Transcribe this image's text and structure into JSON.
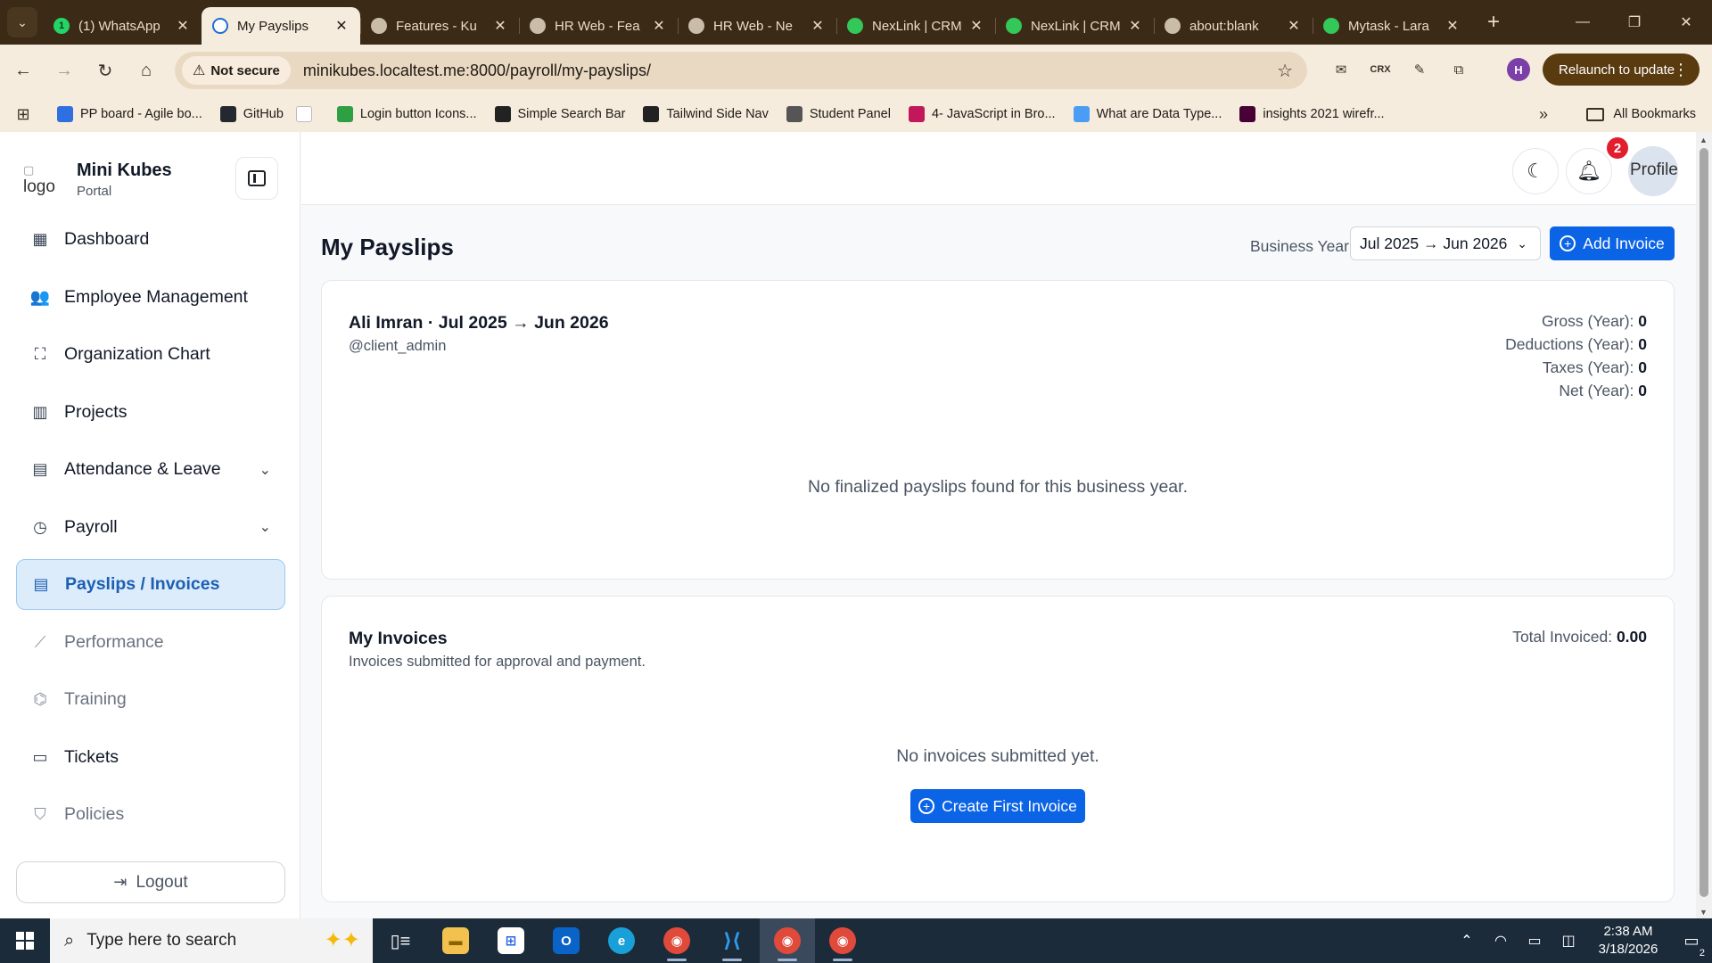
{
  "browser": {
    "tabs": [
      {
        "title": "(1) WhatsApp",
        "icon": "whatsapp-icon",
        "badge": "1",
        "color": "#25d366"
      },
      {
        "title": "My Payslips",
        "icon": "app-page-icon",
        "color": "#ffffff",
        "active": true
      },
      {
        "title": "Features - Ku",
        "icon": "globe-icon",
        "color": "#c9bca8"
      },
      {
        "title": "HR Web - Fea",
        "icon": "globe-icon",
        "color": "#c9bca8"
      },
      {
        "title": "HR Web - Ne",
        "icon": "globe-icon",
        "color": "#c9bca8"
      },
      {
        "title": "NexLink | CRM",
        "icon": "nexlink-icon",
        "color": "#34c759"
      },
      {
        "title": "NexLink | CRM",
        "icon": "nexlink-icon",
        "color": "#34c759"
      },
      {
        "title": "about:blank",
        "icon": "globe-icon",
        "color": "#c9bca8"
      },
      {
        "title": "Mytask - Lara",
        "icon": "nexlink-icon",
        "color": "#34c759"
      }
    ],
    "security_label": "Not secure",
    "url": "minikubes.localtest.me:8000/payroll/my-payslips/",
    "profile_initial": "H",
    "relaunch_label": "Relaunch to update",
    "bookmarks": [
      {
        "label": "PP board - Agile bo...",
        "color": "#2f6fdf"
      },
      {
        "label": "GitHub",
        "color": "#24292f"
      },
      {
        "label": "",
        "color": "#ffffff"
      },
      {
        "label": "Login button Icons...",
        "color": "#2ea043"
      },
      {
        "label": "Simple Search Bar",
        "color": "#222222"
      },
      {
        "label": "Tailwind Side Nav",
        "color": "#222222"
      },
      {
        "label": "Student Panel",
        "color": "#555555"
      },
      {
        "label": "4- JavaScript in Bro...",
        "color": "#c2185b"
      },
      {
        "label": "What are Data Type...",
        "color": "#4b9cf5"
      },
      {
        "label": "insights 2021 wirefr...",
        "color": "#470137"
      }
    ],
    "all_bookmarks_label": "All Bookmarks"
  },
  "sidebar": {
    "logo_alt": "logo",
    "brand_name": "Mini Kubes",
    "brand_sub": "Portal",
    "items": [
      {
        "label": "Dashboard",
        "icon": "grid-icon",
        "glyph": "▦"
      },
      {
        "label": "Employee Management",
        "icon": "users-icon",
        "glyph": "👥"
      },
      {
        "label": "Organization Chart",
        "icon": "org-chart-icon",
        "glyph": "⛶"
      },
      {
        "label": "Projects",
        "icon": "kanban-icon",
        "glyph": "▥"
      },
      {
        "label": "Attendance & Leave",
        "icon": "calendar-icon",
        "glyph": "▤",
        "has_children": true
      },
      {
        "label": "Payroll",
        "icon": "payroll-icon",
        "glyph": "◷",
        "has_children": true
      },
      {
        "label": "Payslips / Invoices",
        "icon": "document-icon",
        "glyph": "▤",
        "active": true
      },
      {
        "label": "Performance",
        "icon": "chart-line-icon",
        "glyph": "⟋",
        "dim": true
      },
      {
        "label": "Training",
        "icon": "graduation-icon",
        "glyph": "⌬",
        "dim": true
      },
      {
        "label": "Tickets",
        "icon": "ticket-icon",
        "glyph": "▭"
      },
      {
        "label": "Policies",
        "icon": "shield-icon",
        "glyph": "⛉",
        "dim": true
      }
    ],
    "logout_label": "Logout"
  },
  "topbar": {
    "notification_count": "2",
    "profile_alt": "Profile"
  },
  "main": {
    "title": "My Payslips",
    "business_year_label": "Business Year",
    "business_year_value": "Jul 2025 → Jun 2026",
    "add_invoice_label": "Add Invoice",
    "payslips": {
      "heading": "Ali Imran · Jul 2025 → Jun 2026",
      "username": "@client_admin",
      "totals": [
        {
          "label": "Gross (Year):",
          "value": "0"
        },
        {
          "label": "Deductions (Year):",
          "value": "0"
        },
        {
          "label": "Taxes (Year):",
          "value": "0"
        },
        {
          "label": "Net (Year):",
          "value": "0"
        }
      ],
      "empty_text": "No finalized payslips found for this business year."
    },
    "invoices": {
      "heading": "My Invoices",
      "subtitle": "Invoices submitted for approval and payment.",
      "total_label": "Total Invoiced:",
      "total_value": "0.00",
      "empty_text": "No invoices submitted yet.",
      "create_label": "Create First Invoice"
    }
  },
  "taskbar": {
    "search_placeholder": "Type here to search",
    "time": "2:38 AM",
    "date": "3/18/2026",
    "notification_count": "2"
  },
  "colors": {
    "primary": "#0b63e5",
    "active_bg": "#dcecfb",
    "badge": "#e11d2e"
  }
}
